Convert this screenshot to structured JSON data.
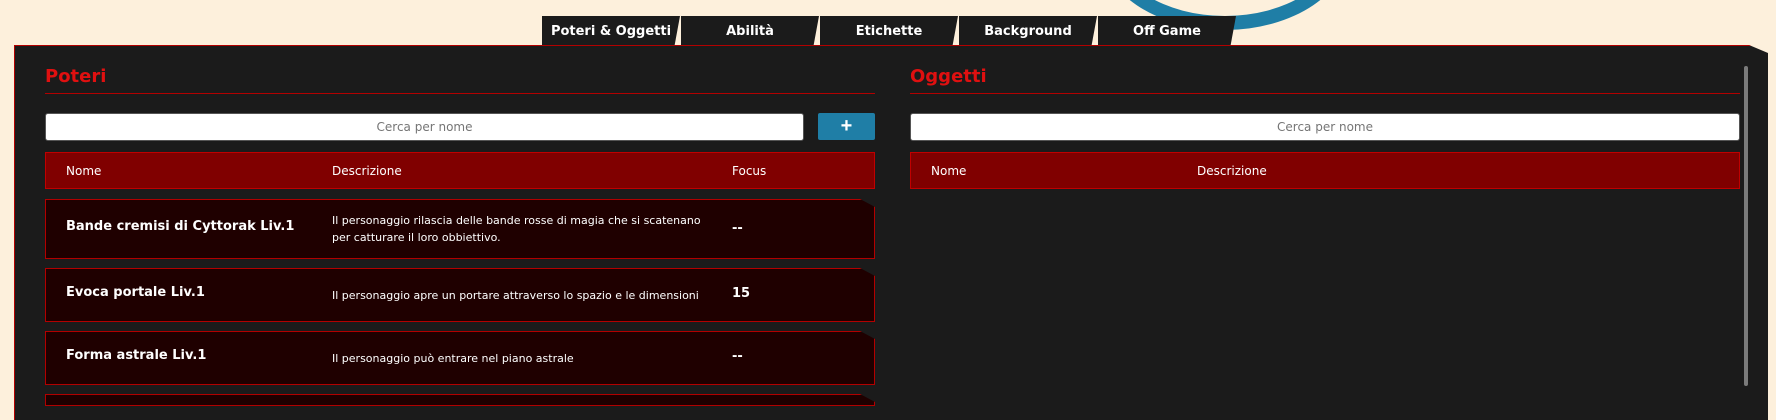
{
  "tabs": [
    {
      "label": "Poteri & Oggetti"
    },
    {
      "label": "Abilità"
    },
    {
      "label": "Etichette"
    },
    {
      "label": "Background"
    },
    {
      "label": "Off Game"
    }
  ],
  "poteri": {
    "title": "Poteri",
    "search_placeholder": "Cerca per nome",
    "add_label": "+",
    "columns": [
      "Nome",
      "Descrizione",
      "Focus"
    ],
    "rows": [
      {
        "name": "Bande cremisi di Cyttorak Liv.1",
        "desc": "Il personaggio rilascia delle bande rosse di magia che si scatenano per catturare il loro obbiettivo.",
        "focus": "--"
      },
      {
        "name": "Evoca portale Liv.1",
        "desc": "Il personaggio apre un portare attraverso lo spazio e le dimensioni",
        "focus": "15"
      },
      {
        "name": "Forma astrale Liv.1",
        "desc": "Il personaggio può entrare nel piano astrale",
        "focus": "--"
      }
    ]
  },
  "oggetti": {
    "title": "Oggetti",
    "search_placeholder": "Cerca per nome",
    "columns": [
      "Nome",
      "Descrizione"
    ]
  },
  "colors": {
    "accent_red": "#e01010",
    "header_red": "#800000",
    "panel_bg": "#1b1b1b",
    "button_blue": "#1f7ea6",
    "page_bg": "#fdf0dc"
  }
}
